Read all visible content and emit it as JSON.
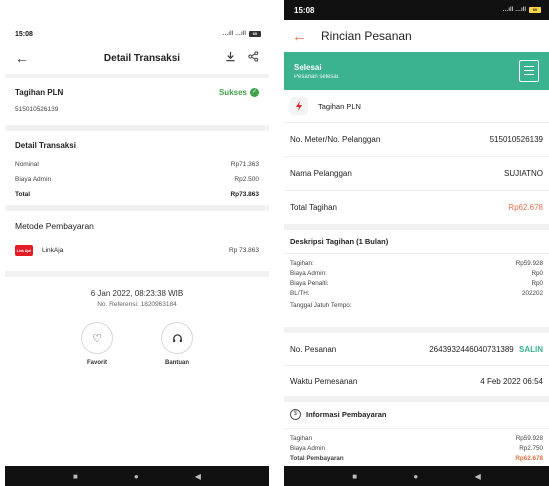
{
  "left": {
    "status": {
      "time": "15:08",
      "signal": "…ıll …ıll",
      "battery": "60"
    },
    "appbar": {
      "title": "Detail Transaksi"
    },
    "bill": {
      "title": "Tagihan PLN",
      "status": "Sukses",
      "number": "515010526139"
    },
    "detail": {
      "title": "Detail Transaksi",
      "rows": [
        {
          "label": "Nominal",
          "value": "Rp71.363"
        },
        {
          "label": "Biaya Admin",
          "value": "Rp2.500"
        },
        {
          "label": "Total",
          "value": "Rp73.863"
        }
      ]
    },
    "payment": {
      "title": "Metode Pembayaran",
      "method": "LinkAja",
      "amount": "Rp 73.863",
      "logo_text": "Link Aja!"
    },
    "footer": {
      "datetime": "6 Jan 2022, 08:23:38 WIB",
      "reference": "No. Referensi: 1820963184",
      "favorite_label": "Favorit",
      "help_label": "Bantuan"
    }
  },
  "right": {
    "status": {
      "time": "15:08",
      "signal": "…ıll …ıll",
      "battery": "60"
    },
    "appbar": {
      "title": "Rincian Pesanan"
    },
    "banner": {
      "title": "Selesai",
      "subtitle": "Pesanan selesai."
    },
    "product": {
      "title": "Tagihan PLN"
    },
    "info": [
      {
        "label": "No. Meter/No. Pelanggan",
        "value": "515010526139"
      },
      {
        "label": "Nama Pelanggan",
        "value": "SUJIATNO"
      },
      {
        "label": "Total Tagihan",
        "value": "Rp62.678"
      }
    ],
    "description": {
      "title": "Deskripsi Tagihan (1 Bulan)",
      "rows": [
        {
          "label": "Tagihan:",
          "value": "Rp59.928"
        },
        {
          "label": "Biaya Admin:",
          "value": "Rp0"
        },
        {
          "label": "Biaya Penalti:",
          "value": "Rp0"
        },
        {
          "label": "BL/TH:",
          "value": "202202"
        },
        {
          "label": "Tanggal Jatuh Tempo:",
          "value": ""
        }
      ]
    },
    "order": {
      "number_label": "No. Pesanan",
      "number": "2643932446040731389",
      "copy_label": "SALIN",
      "time_label": "Waktu Pemesanan",
      "time": "4 Feb 2022 06:54"
    },
    "payment_info": {
      "title": "Informasi Pembayaran",
      "rows": [
        {
          "label": "Tagihan",
          "value": "Rp59.928"
        },
        {
          "label": "Biaya Admin",
          "value": "Rp2.750"
        },
        {
          "label": "Total Pembayaran",
          "value": "Rp62.678"
        }
      ]
    }
  },
  "colors": {
    "success": "#41a14a",
    "banner": "#3bb38f",
    "accent": "#e8704a",
    "linkaja": "#e21d25"
  }
}
